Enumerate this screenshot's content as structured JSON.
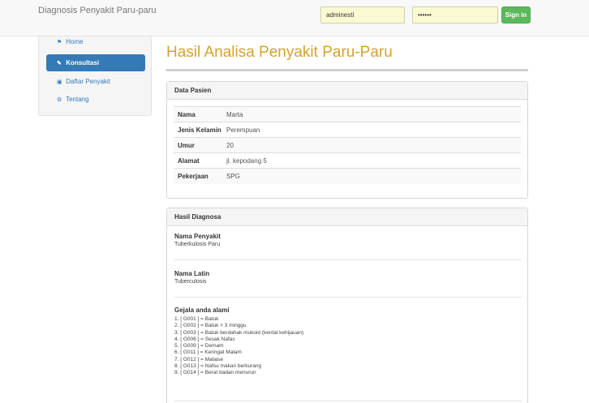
{
  "navbar": {
    "brand": "Diagnosis Penyakit Paru-paru",
    "username_value": "adminesti",
    "password_value": "••••••",
    "signin_label": "Sign in"
  },
  "sidebar": {
    "items": [
      {
        "label": "Home",
        "icon": "home-icon"
      },
      {
        "label": "Konsultasi",
        "icon": "pencil-icon"
      },
      {
        "label": "Daftar Penyakit",
        "icon": "book-icon"
      },
      {
        "label": "Tentang",
        "icon": "gears-icon"
      }
    ],
    "active_index": 1
  },
  "page": {
    "title": "Hasil Analisa Penyakit Paru-Paru"
  },
  "data_pasien": {
    "heading": "Data Pasien",
    "rows": [
      {
        "key": "Nama",
        "value": "Marta"
      },
      {
        "key": "Jenis Kelamin",
        "value": "Perempuan"
      },
      {
        "key": "Umur",
        "value": "20"
      },
      {
        "key": "Alamat",
        "value": "jl. kepodang 5"
      },
      {
        "key": "Pekerjaan",
        "value": "SPG"
      }
    ]
  },
  "hasil_diagnosa": {
    "heading": "Hasil Diagnosa",
    "nama_penyakit_label": "Nama Penyakit",
    "nama_penyakit": "Tuberkulosis Paru",
    "nama_latin_label": "Nama Latin",
    "nama_latin": "Tuberculosis",
    "gejala_label": "Gejala anda alami",
    "gejala": [
      "1. [ G001 ] = Batuk",
      "2. [ G002 ] = Batuk > 3 minggu",
      "3. [ G003 ] = Batuk berdahak mukoid (kental kehijauan)",
      "4. [ G006 ] = Sesak Nafas",
      "5. [ G009 ] = Demam",
      "6. [ G011 ] = Keringat Malam",
      "7. [ G012 ] = Malaise",
      "8. [ G013 ] = Nafsu makan berkurang",
      "9. [ G014 ] = Berat badan menurun"
    ]
  },
  "colors": {
    "accent": "#337ab7",
    "title": "#d4a32e",
    "signin": "#5cb85c",
    "input_bg": "#fafad2"
  }
}
